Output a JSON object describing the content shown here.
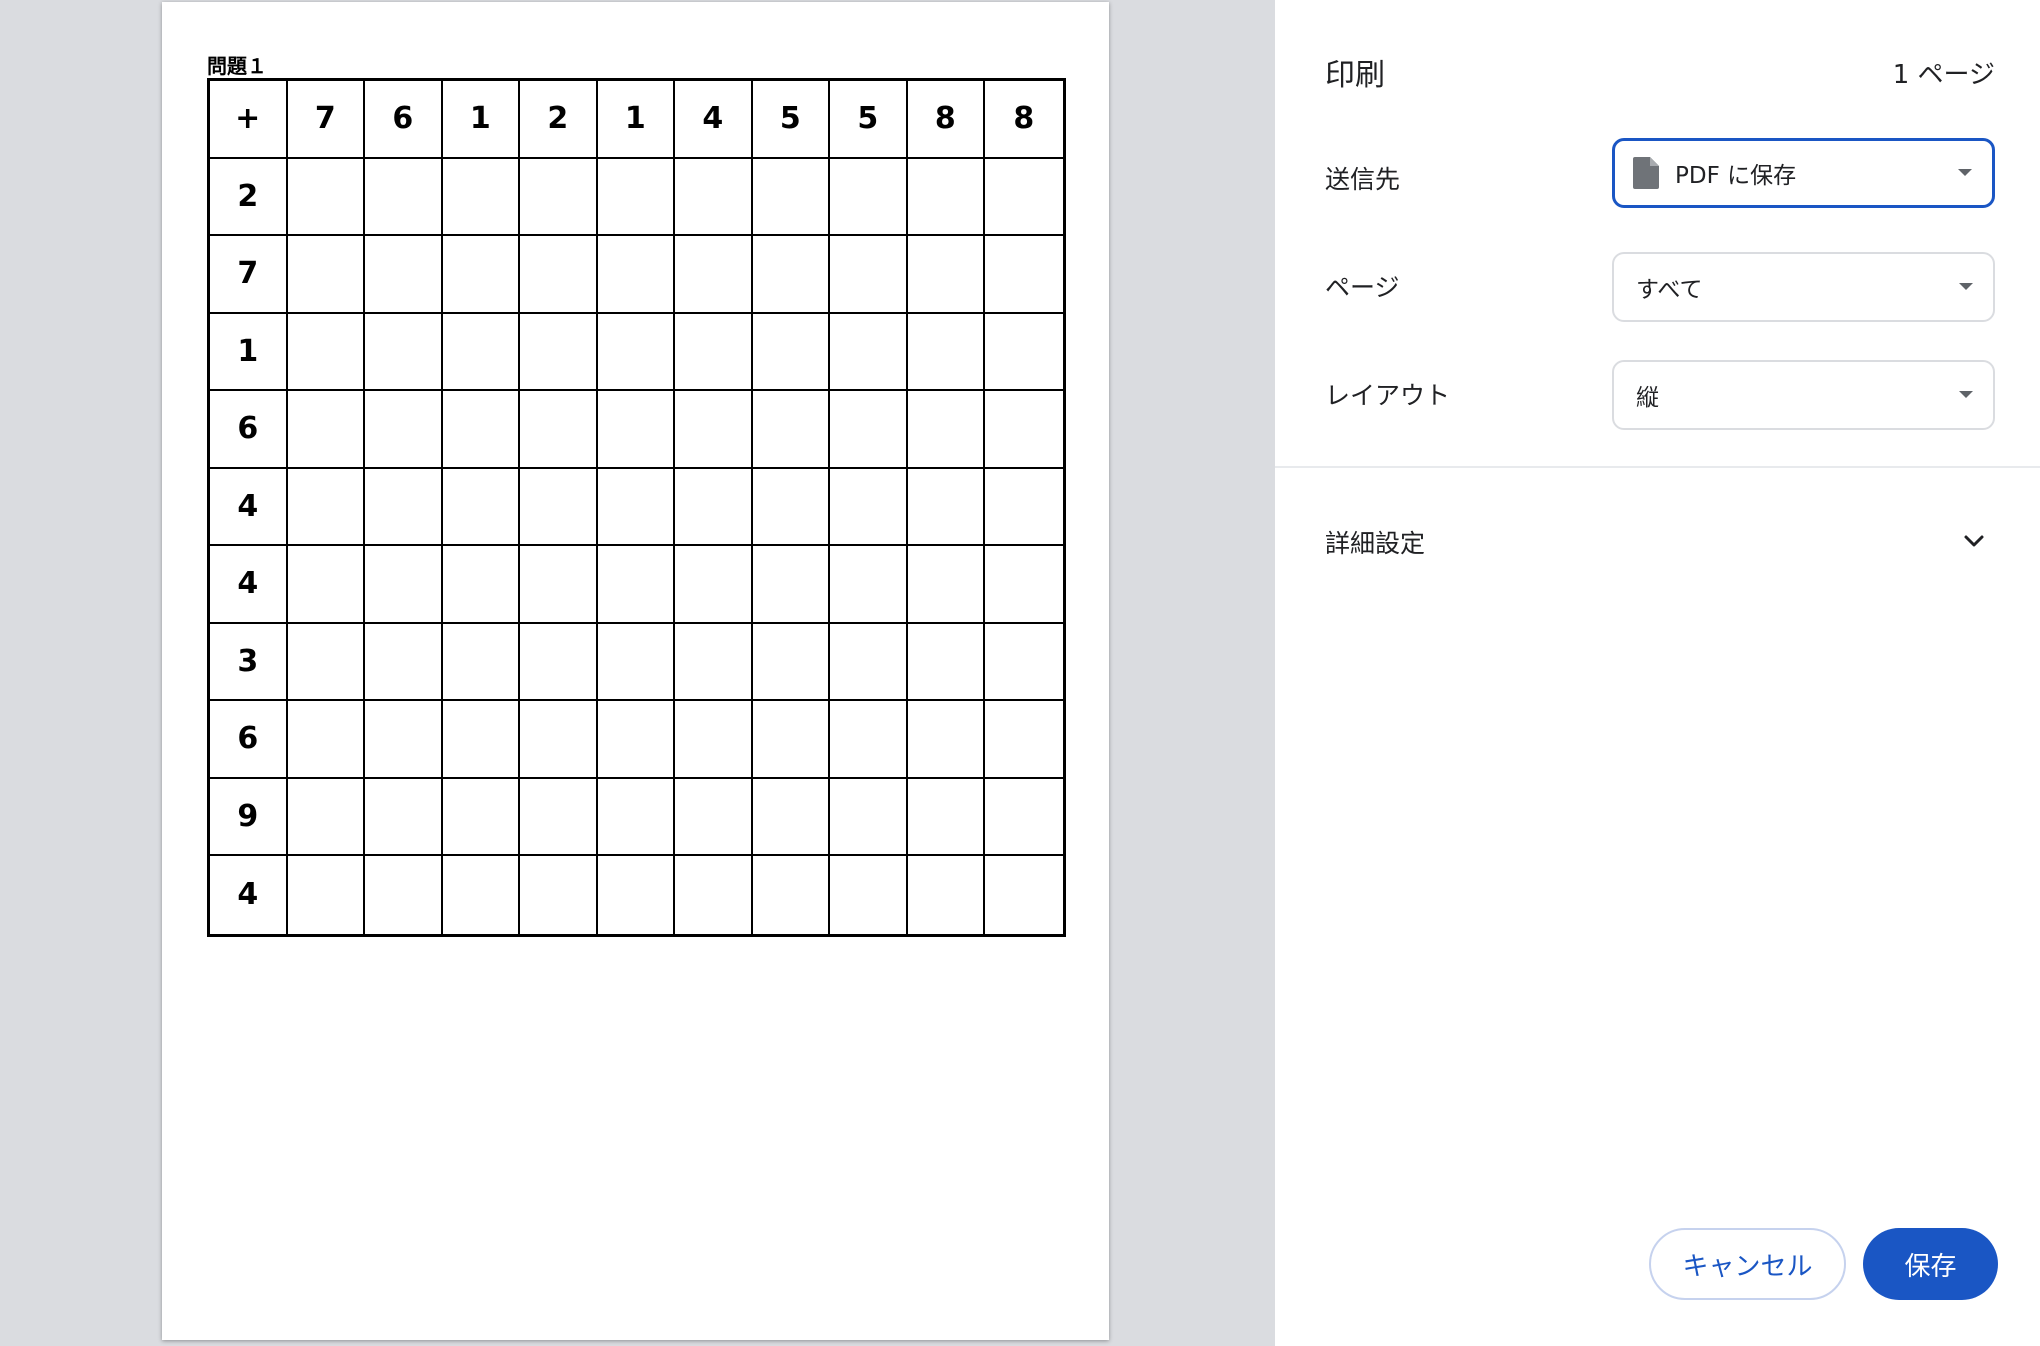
{
  "preview": {
    "problem_title": "問題１",
    "table": {
      "corner": "+",
      "column_headers": [
        "7",
        "6",
        "1",
        "2",
        "1",
        "4",
        "5",
        "5",
        "8",
        "8"
      ],
      "row_headers": [
        "2",
        "7",
        "1",
        "6",
        "4",
        "4",
        "3",
        "6",
        "9",
        "4"
      ]
    }
  },
  "settings": {
    "title": "印刷",
    "page_count": "1 ページ",
    "destination": {
      "label": "送信先",
      "value": "PDF に保存",
      "icon": "document-icon"
    },
    "pages": {
      "label": "ページ",
      "value": "すべて"
    },
    "layout": {
      "label": "レイアウト",
      "value": "縦"
    },
    "more_settings": {
      "label": "詳細設定",
      "icon": "chevron-down-icon"
    },
    "buttons": {
      "cancel": "キャンセル",
      "save": "保存"
    },
    "colors": {
      "accent": "#1a56c4",
      "preview_bg": "#dadce0"
    }
  }
}
